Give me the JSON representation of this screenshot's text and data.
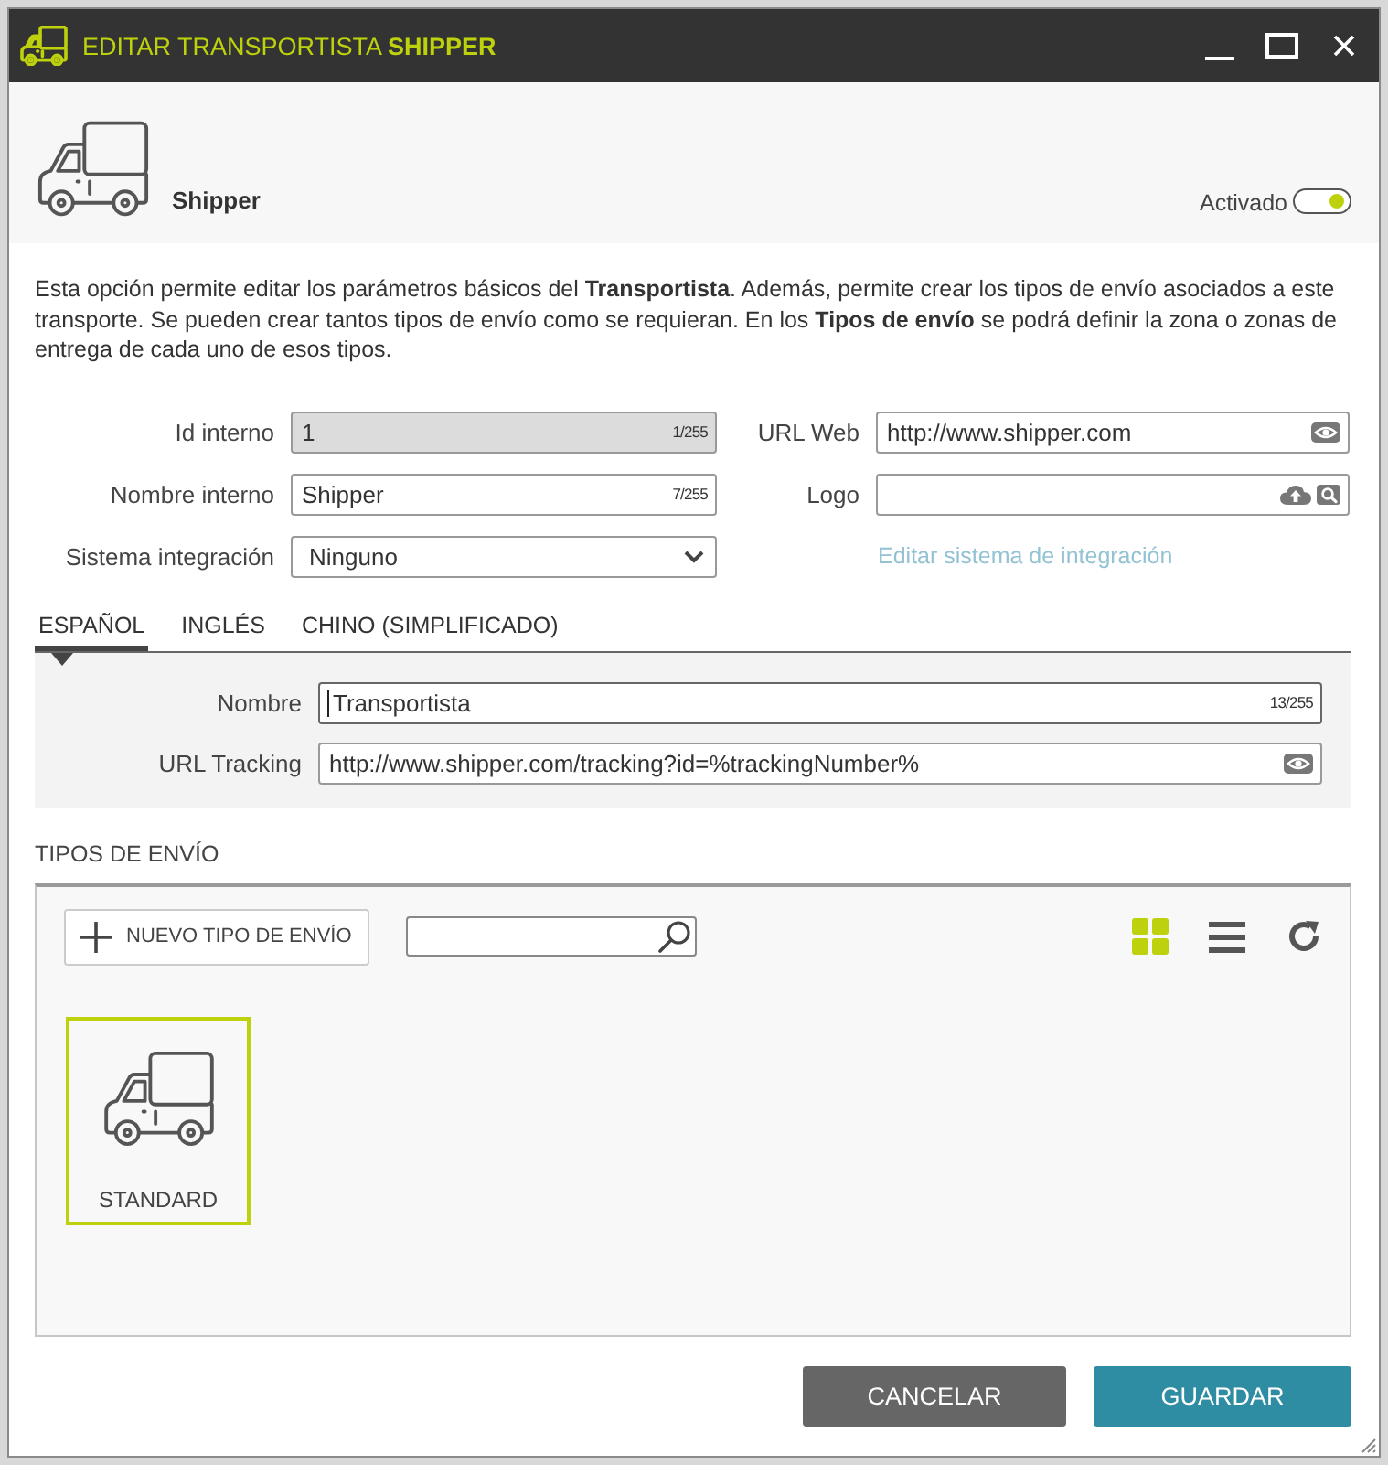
{
  "window": {
    "title": "EDITAR TRANSPORTISTA **SHIPPER**"
  },
  "header": {
    "name": "Shipper",
    "toggle_label": "Activado",
    "active": true
  },
  "description": "Esta opción permite editar los parámetros básicos del **Transportista**. Además, permite crear los tipos de envío asociados a este transporte. Se pueden crear tantos tipos de envío como se requieran. En los **Tipos de envío** se podrá definir la zona o zonas de entrega de cada uno de esos tipos.",
  "form": {
    "left": [
      {
        "kind": "text",
        "label": "Id interno",
        "value": "1",
        "counter": "1/255",
        "disabled": true
      },
      {
        "kind": "text",
        "label": "Nombre interno",
        "value": "Shipper",
        "counter": "7/255",
        "disabled": false
      },
      {
        "kind": "select",
        "label": "Sistema integración",
        "value": "Ninguno",
        "disabled": false
      }
    ],
    "right": [
      {
        "kind": "url",
        "label": "URL Web",
        "value": "http://www.shipper.com"
      },
      {
        "kind": "file",
        "label": "Logo"
      }
    ],
    "link": "Editar sistema de integración"
  },
  "language_tabs": [
    {
      "label": "ESPAÑOL",
      "selected": true
    },
    {
      "label": "INGLÉS",
      "selected": false
    },
    {
      "label": "CHINO (SIMPLIFICADO)",
      "selected": false
    }
  ],
  "language_fields": [
    {
      "kind": "text",
      "label": "Nombre",
      "value": "Transportista",
      "counter": "13/255",
      "focused": true
    },
    {
      "kind": "url",
      "label": "URL Tracking",
      "value": "http://www.shipper.com/tracking?id=%trackingNumber%",
      "focused": false
    }
  ],
  "shipping_types": {
    "title": "TIPOS DE ENVÍO",
    "new_button": "NUEVO TIPO DE ENVÍO",
    "views": [
      {
        "kind": "grid",
        "selected": true
      },
      {
        "kind": "list",
        "selected": false
      }
    ],
    "items": [
      {
        "label": "STANDARD",
        "selected": true
      }
    ]
  },
  "buttons": [
    {
      "kind": "secondary",
      "label": "CANCELAR"
    },
    {
      "kind": "primary",
      "label": "GUARDAR"
    }
  ]
}
